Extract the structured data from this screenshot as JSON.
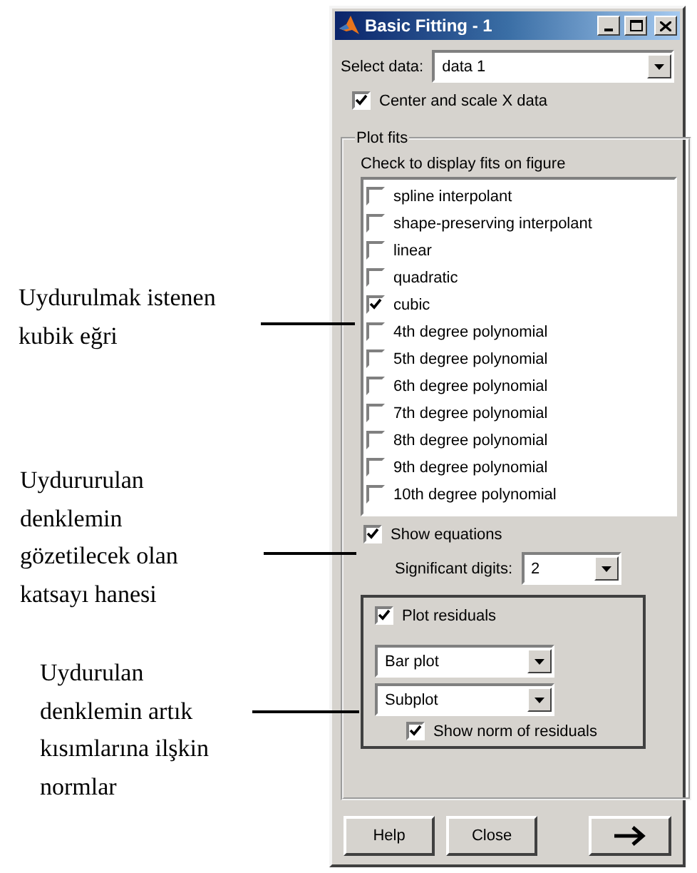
{
  "annotations": [
    {
      "lines": [
        "Uydurulmak istenen",
        "kubik eğri"
      ]
    },
    {
      "lines": [
        "Uydururulan",
        "denklemin",
        "gözetilecek olan",
        "katsayı hanesi"
      ]
    },
    {
      "lines": [
        "Uydurulan",
        "denklemin artık",
        "kısımlarına ilşkin",
        "normlar"
      ]
    }
  ],
  "window": {
    "title": "Basic Fitting - 1"
  },
  "select_data": {
    "label": "Select data:",
    "value": "data 1"
  },
  "center_scale": {
    "label": "Center and scale X data",
    "checked": true
  },
  "plot_fits": {
    "title": "Plot fits",
    "hint": "Check to display fits on figure",
    "fits": [
      {
        "label": "spline interpolant",
        "checked": false
      },
      {
        "label": "shape-preserving interpolant",
        "checked": false
      },
      {
        "label": "linear",
        "checked": false
      },
      {
        "label": "quadratic",
        "checked": false
      },
      {
        "label": "cubic",
        "checked": true
      },
      {
        "label": "4th degree polynomial",
        "checked": false
      },
      {
        "label": "5th degree polynomial",
        "checked": false
      },
      {
        "label": "6th degree polynomial",
        "checked": false
      },
      {
        "label": "7th degree polynomial",
        "checked": false
      },
      {
        "label": "8th degree polynomial",
        "checked": false
      },
      {
        "label": "9th degree polynomial",
        "checked": false
      },
      {
        "label": "10th degree polynomial",
        "checked": false
      }
    ]
  },
  "show_equations": {
    "label": "Show equations",
    "checked": true
  },
  "significant_digits": {
    "label": "Significant digits:",
    "value": "2"
  },
  "residuals": {
    "label": "Plot residuals",
    "checked": true,
    "plot_type": "Bar plot",
    "placement": "Subplot",
    "show_norm": {
      "label": "Show norm of residuals",
      "checked": true
    }
  },
  "buttons": [
    {
      "label": "Help"
    },
    {
      "label": "Close"
    }
  ]
}
